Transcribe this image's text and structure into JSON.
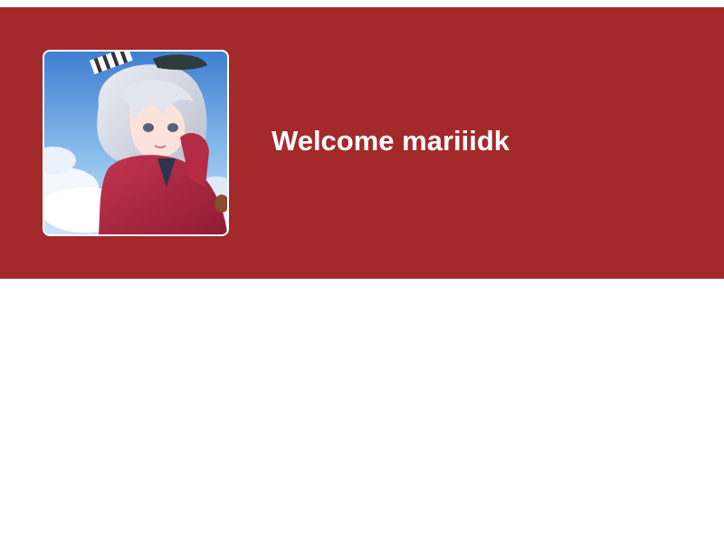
{
  "header": {
    "welcome_text": "Welcome mariiidk",
    "background_color": "#a3292a",
    "text_color": "#ffffff"
  },
  "avatar": {
    "description_icon": "user-avatar-image",
    "border_color": "#ffffff"
  },
  "page": {
    "background_color": "#ffffff"
  }
}
